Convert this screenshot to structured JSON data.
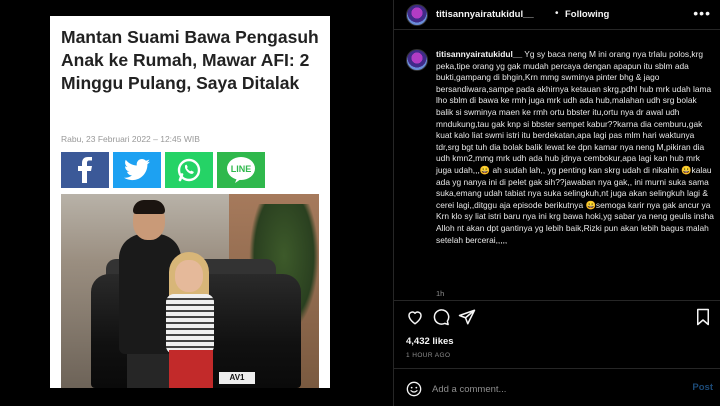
{
  "post": {
    "username": "titisannyairatukidul__",
    "follow_label": "Following",
    "more_glyph": "•••",
    "dot": "•",
    "caption_text": " Yg sy baca neng M ini orang nya trlalu polos,krg peka,tipe orang yg gak mudah percaya dengan apapun itu sblm ada bukti,gampang di bhgin,Krn mmg swminya pinter bhg & jago bersandiwara,sampe pada akhirnya ketauan skrg,pdhl hub mrk udah lama lho sblm di bawa ke rmh juga mrk udh ada hub,malahan udh srg bolak balik si swminya maen ke rmh ortu bbster itu,ortu nya dr awal udh mndukung,tau gak knp si bbster sempet kabur??karna dia cemburu,gak kuat kalo liat swmi istri itu berdekatan,apa lagi pas mlm hari waktunya tdr,srg bgt tuh dia bolak balik lewat ke dpn kamar nya neng M,pikiran dia udh kmn2,mmg mrk udh ada hub jdnya cembokur,apa lagi kan hub mrk juga udah,,,😀 ah sudah lah,, yg penting kan skrg udah di nikahin 😀kalau ada yg nanya ini di pelet gak sih??jawaban nya gak,, ini murni suka sama suka,emang udah tabiat nya suka selingkuh,nt juga akan selingkuh lagi & cerei lagi,,ditggu aja episode berikutnya 😀semoga karir nya gak ancur ya Krn klo sy liat istri baru nya ini krg bawa hoki,yg sabar ya neng geulis insha Alloh nt akan dpt gantinya yg lebih baik,Rizki pun akan lebih bagus malah setelah bercerai,,,,,",
    "caption_time": "1h",
    "likes": "4,432 likes",
    "posted_ago": "1 HOUR AGO",
    "comment_placeholder": "Add a comment...",
    "post_label": "Post"
  },
  "article": {
    "headline": "Mantan Suami Bawa Pengasuh Anak ke Rumah, Mawar AFI: 2 Minggu Pulang, Saya Ditalak",
    "date": "Rabu, 23 Februari 2022 – 12:45 WIB",
    "share_buttons": [
      "facebook",
      "twitter",
      "whatsapp",
      "line"
    ],
    "line_label": "LINE",
    "plate_text": "AV1"
  },
  "colors": {
    "background": "#000000",
    "border": "#262626",
    "text": "#f5f5f5",
    "muted": "#8e8e8e",
    "facebook": "#3b5998",
    "twitter": "#1da1f2",
    "whatsapp": "#25d366",
    "line": "#2fb84c",
    "post_disabled": "#1c4a77"
  },
  "icons": [
    "heart-icon",
    "comment-icon",
    "share-icon",
    "bookmark-icon",
    "smiley-icon",
    "more-icon"
  ]
}
